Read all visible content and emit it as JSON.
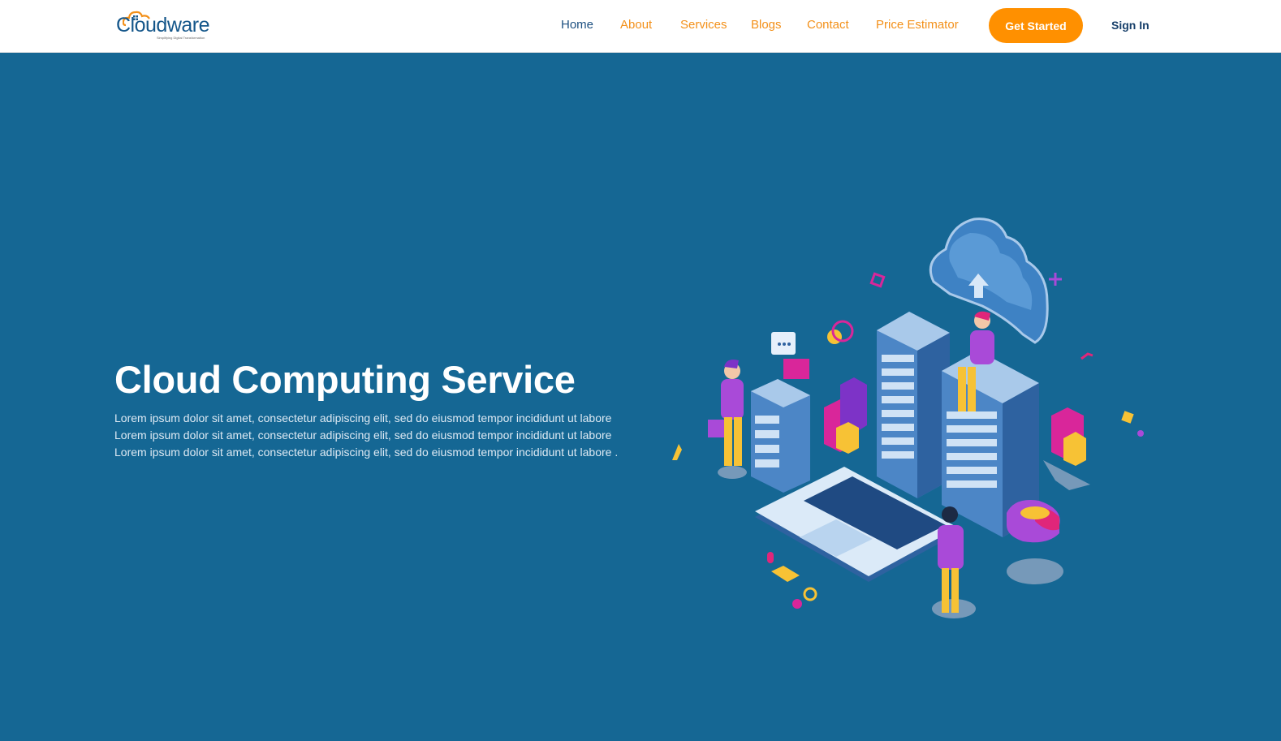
{
  "brand": {
    "name": "Cloudware",
    "tagline": "Simplifying Digital Transformation"
  },
  "nav": {
    "items": [
      {
        "label": "Home",
        "active": true
      },
      {
        "label": "About",
        "active": false
      },
      {
        "label": "Services",
        "active": false
      },
      {
        "label": "Blogs",
        "active": false
      },
      {
        "label": "Contact",
        "active": false
      },
      {
        "label": "Price Estimator",
        "active": false
      }
    ],
    "cta_label": "Get Started",
    "signin_label": "Sign In"
  },
  "hero": {
    "title": "Cloud Computing Service",
    "text": "Lorem ipsum dolor sit amet, consectetur adipiscing elit, sed do eiusmod tempor incididunt ut labore Lorem ipsum dolor sit amet, consectetur adipiscing elit, sed do eiusmod tempor incididunt ut labore Lorem ipsum dolor sit amet, consectetur adipiscing elit, sed do eiusmod tempor incididunt ut labore ."
  },
  "colors": {
    "hero_bg": "#156794",
    "accent": "#ff9000",
    "nav_link": "#f39019",
    "nav_active": "#1c4f80"
  },
  "icons": [
    "cloud-logo-icon",
    "cloud-upload-illustration",
    "server-rack-illustration",
    "laptop-illustration"
  ]
}
